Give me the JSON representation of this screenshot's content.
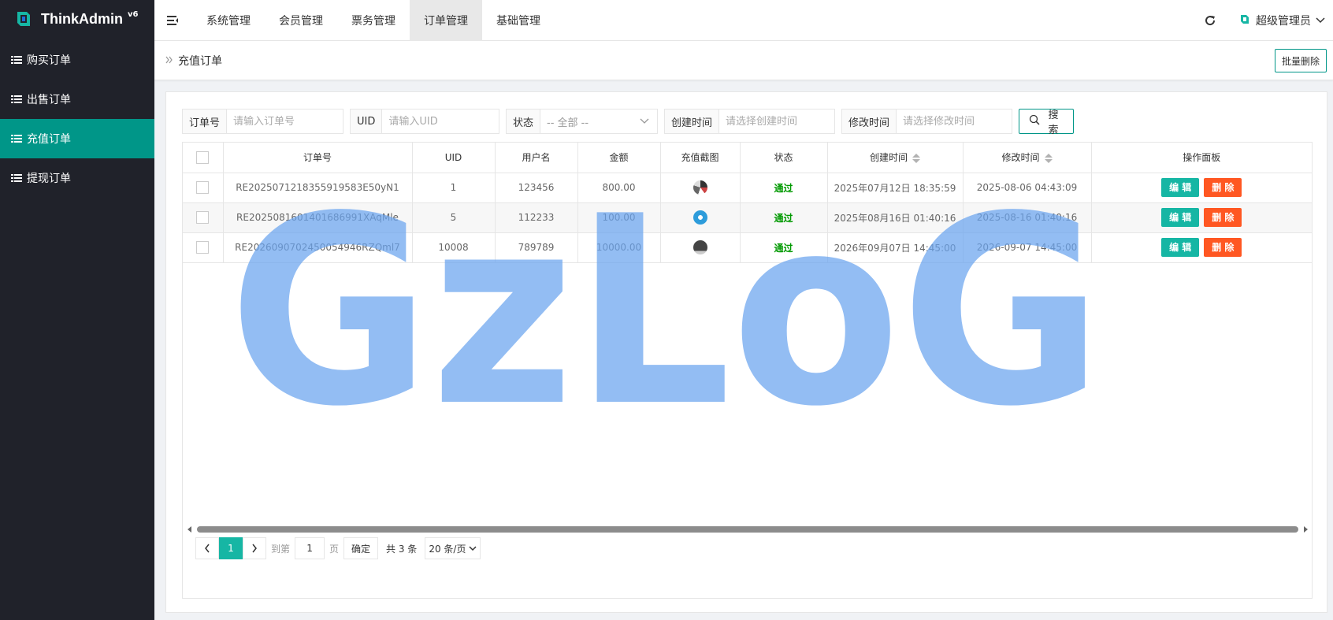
{
  "app": {
    "name": "ThinkAdmin",
    "version": "v6"
  },
  "sidebar": {
    "items": [
      {
        "label": "购买订单",
        "active": false
      },
      {
        "label": "出售订单",
        "active": false
      },
      {
        "label": "充值订单",
        "active": true
      },
      {
        "label": "提现订单",
        "active": false
      }
    ]
  },
  "header": {
    "tabs": [
      {
        "label": "系统管理",
        "active": false
      },
      {
        "label": "会员管理",
        "active": false
      },
      {
        "label": "票务管理",
        "active": false
      },
      {
        "label": "订单管理",
        "active": true
      },
      {
        "label": "基础管理",
        "active": false
      }
    ],
    "user": "超级管理员"
  },
  "breadcrumb": {
    "title": "充值订单",
    "batch_delete": "批量删除"
  },
  "search": {
    "order_no": {
      "label": "订单号",
      "placeholder": "请输入订单号"
    },
    "uid": {
      "label": "UID",
      "placeholder": "请输入UID"
    },
    "status": {
      "label": "状态",
      "value": "-- 全部 --"
    },
    "create_time": {
      "label": "创建时间",
      "placeholder": "请选择创建时间"
    },
    "update_time": {
      "label": "修改时间",
      "placeholder": "请选择修改时间"
    },
    "button": "搜 索"
  },
  "table": {
    "columns": [
      "订单号",
      "UID",
      "用户名",
      "金额",
      "充值截图",
      "状态",
      "创建时间",
      "修改时间",
      "操作面板"
    ],
    "rows": [
      {
        "order_no": "RE2025071218355919583E50yN1",
        "uid": "1",
        "username": "123456",
        "amount": "800.00",
        "status": "通过",
        "create_time": "2025年07月12日 18:35:59",
        "update_time": "2025-08-06 04:43:09"
      },
      {
        "order_no": "RE2025081601401686991XAqMle",
        "uid": "5",
        "username": "112233",
        "amount": "100.00",
        "status": "通过",
        "create_time": "2025年08月16日 01:40:16",
        "update_time": "2025-08-16 01:40:16"
      },
      {
        "order_no": "RE2026090702450054946RZQml7",
        "uid": "10008",
        "username": "789789",
        "amount": "10000.00",
        "status": "通过",
        "create_time": "2026年09月07日 14:45:00",
        "update_time": "2026-09-07 14:45:00"
      }
    ],
    "edit_label": "编 辑",
    "delete_label": "删 除"
  },
  "pager": {
    "current": "1",
    "goto_prefix": "到第",
    "goto_value": "1",
    "goto_suffix": "页",
    "confirm": "确定",
    "total": "共 3 条",
    "page_size": "20 条/页"
  },
  "watermark": {
    "text": "GzLoG",
    "color": "#6aa3ef"
  },
  "colors": {
    "sidebar_bg": "#20222a",
    "accent": "#009688",
    "edit": "#16b6a4",
    "delete": "#ff5722",
    "pass": "#009900"
  }
}
